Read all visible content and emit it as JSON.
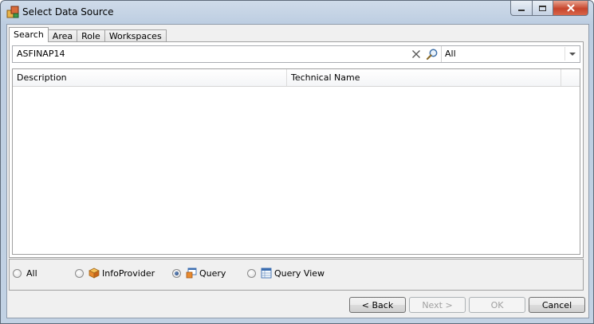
{
  "window": {
    "title": "Select Data Source"
  },
  "tabs": [
    {
      "label": "Search",
      "active": true
    },
    {
      "label": "Area",
      "active": false
    },
    {
      "label": "Role",
      "active": false
    },
    {
      "label": "Workspaces",
      "active": false
    }
  ],
  "search": {
    "value": "ASFINAP14",
    "filter_value": "All"
  },
  "grid": {
    "columns": [
      "Description",
      "Technical Name"
    ],
    "rows": []
  },
  "object_types": {
    "options": [
      {
        "label": "All",
        "icon": "none",
        "checked": false
      },
      {
        "label": "InfoProvider",
        "icon": "cube-icon",
        "checked": false
      },
      {
        "label": "Query",
        "icon": "query-icon",
        "checked": true
      },
      {
        "label": "Query View",
        "icon": "query-view-icon",
        "checked": false
      }
    ]
  },
  "buttons": {
    "back": "< Back",
    "next": "Next >",
    "ok": "OK",
    "cancel": "Cancel"
  },
  "colors": {
    "titlebar": "#bccde1",
    "close_button": "#c7452c",
    "panel_background": "#f0f0f0"
  }
}
